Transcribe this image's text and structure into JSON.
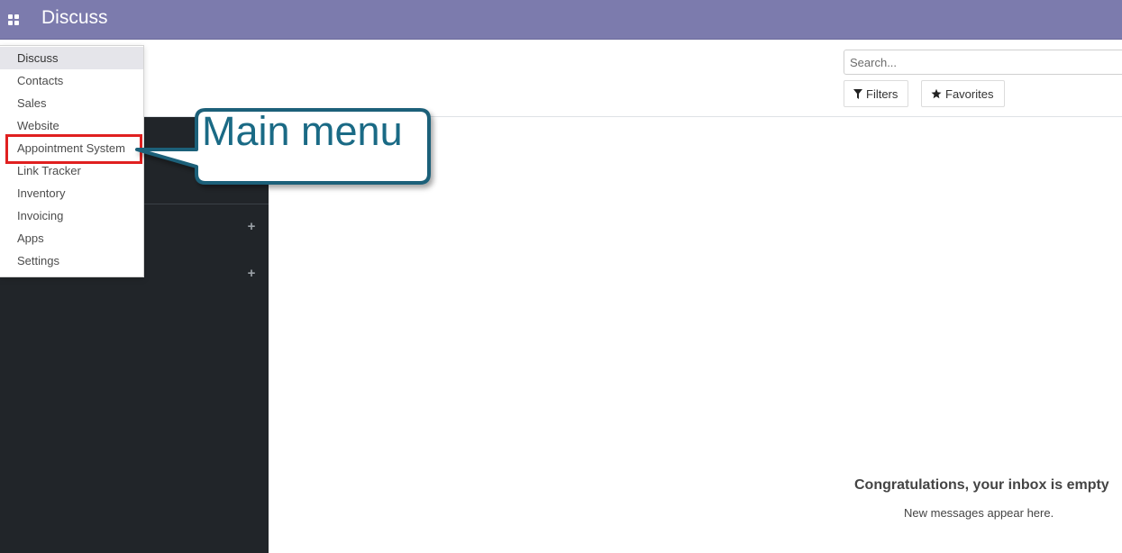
{
  "header": {
    "app_title": "Discuss",
    "apps_icon": "grid-apps-icon"
  },
  "apps_menu": {
    "items": [
      {
        "label": "Discuss",
        "active": true
      },
      {
        "label": "Contacts"
      },
      {
        "label": "Sales"
      },
      {
        "label": "Website"
      },
      {
        "label": "Appointment System",
        "highlighted": true
      },
      {
        "label": "Link Tracker"
      },
      {
        "label": "Inventory"
      },
      {
        "label": "Invoicing"
      },
      {
        "label": "Apps"
      },
      {
        "label": "Settings"
      }
    ]
  },
  "control_panel": {
    "search_placeholder": "Search...",
    "filters_label": "Filters",
    "filters_icon": "filter-icon",
    "favorites_label": "Favorites",
    "favorites_icon": "star-icon"
  },
  "sidebar": {
    "add_icon": "plus-icon"
  },
  "callout": {
    "text": "Main menu"
  },
  "empty_inbox": {
    "title": "Congratulations, your inbox is empty",
    "subtitle": "New messages appear here."
  },
  "colors": {
    "topbar": "#7c7bad",
    "sidebar": "#212529",
    "highlight": "#e02020",
    "callout_border": "#1e6079",
    "callout_text": "#1a6a85"
  }
}
